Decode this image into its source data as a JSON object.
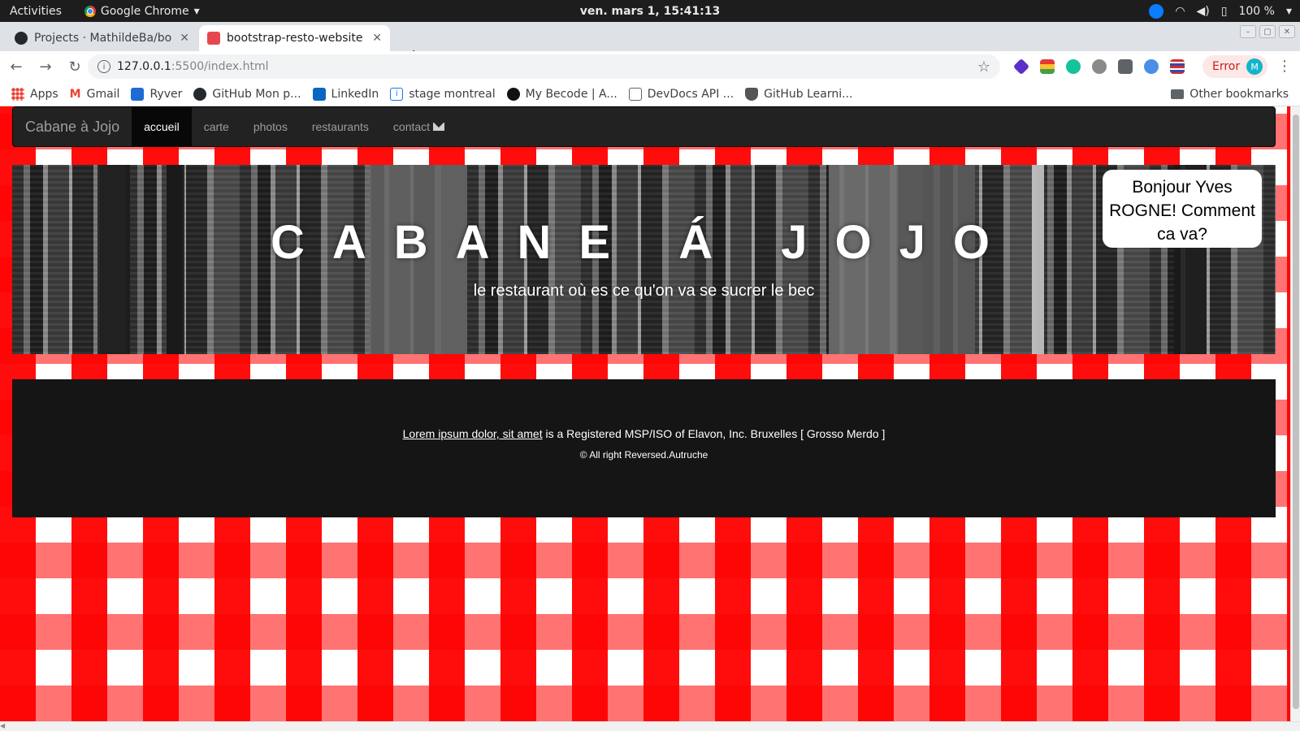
{
  "system": {
    "activities": "Activities",
    "app_name": "Google Chrome",
    "clock": "ven. mars  1, 15:41:13",
    "battery": "100 %"
  },
  "tabs": [
    {
      "title": "Projects · MathildeBa/bo",
      "favicon": "github-icon"
    },
    {
      "title": "bootstrap-resto-website",
      "favicon": "bootstrap-page-icon"
    }
  ],
  "address_bar": {
    "url_host": "127.0.0.1",
    "url_rest": ":5500/index.html"
  },
  "profile": {
    "error_label": "Error",
    "avatar_letter": "M"
  },
  "bookmarks": [
    {
      "label": "Apps",
      "icon": "apps-grid-icon"
    },
    {
      "label": "Gmail",
      "icon": "gmail-icon"
    },
    {
      "label": "Ryver",
      "icon": "ryver-icon"
    },
    {
      "label": "GitHub Mon p...",
      "icon": "github-icon"
    },
    {
      "label": "LinkedIn",
      "icon": "linkedin-icon"
    },
    {
      "label": "stage montreal",
      "icon": "info-icon"
    },
    {
      "label": "My Becode | A...",
      "icon": "becode-icon"
    },
    {
      "label": "DevDocs API ...",
      "icon": "devdocs-icon"
    },
    {
      "label": "GitHub Learni...",
      "icon": "github-learning-icon"
    }
  ],
  "other_bookmarks": "Other bookmarks",
  "site": {
    "brand": "Cabane à Jojo",
    "nav": [
      "accueil",
      "carte",
      "photos",
      "restaurants",
      "contact"
    ],
    "hero_title": "CABANE Á JOJO",
    "hero_subtitle": "le restaurant où es ce qu'on va se sucrer le bec",
    "greeting": "Bonjour Yves ROGNE! Comment ca va?",
    "footer_link": "Lorem ipsum dolor, sit amet",
    "footer_text": " is a Registered MSP/ISO of Elavon, Inc. Bruxelles [ Grosso Merdo ]",
    "copyright": "© All right Reversed.Autruche"
  },
  "colors": {
    "gingham_red": "#ff0000",
    "navbar_bg": "#222222",
    "footer_bg": "#151515"
  }
}
